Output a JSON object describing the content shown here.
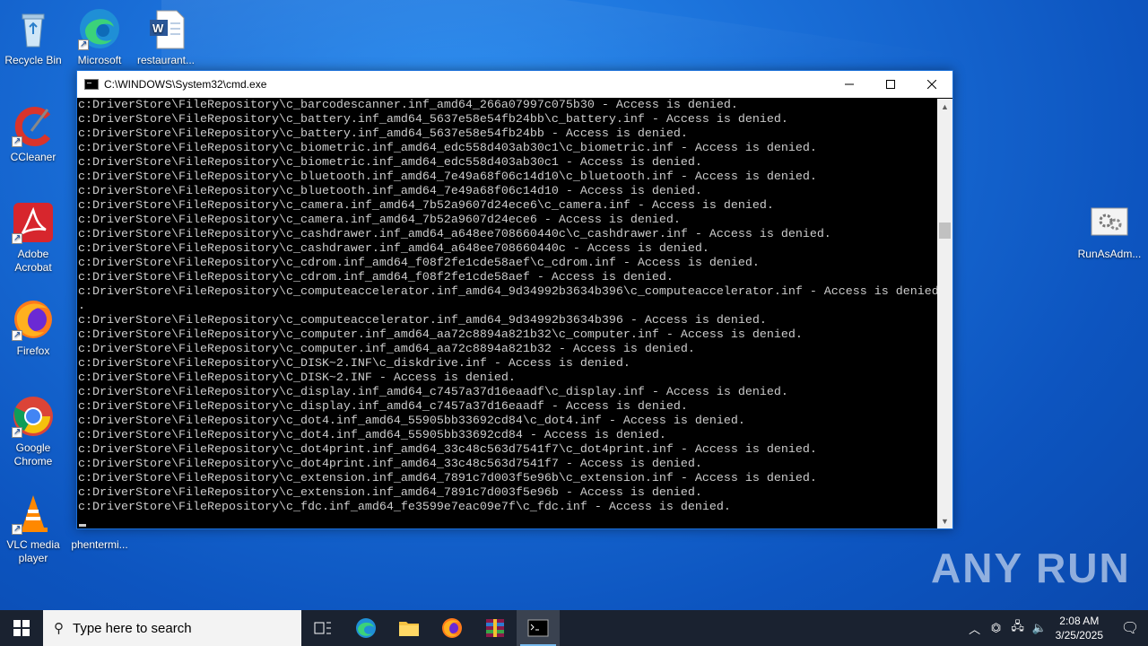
{
  "desktop": {
    "icons": [
      {
        "label": "Recycle Bin"
      },
      {
        "label": "Microsoft Edge"
      },
      {
        "label": "restaurant..."
      },
      {
        "label": "CCleaner"
      },
      {
        "label": "Adobe Acrobat"
      },
      {
        "label": "Firefox"
      },
      {
        "label": "Google Chrome"
      },
      {
        "label": "VLC media player"
      },
      {
        "label": "phentermi..."
      },
      {
        "label": "RunAsAdm..."
      }
    ]
  },
  "cmd": {
    "title": "C:\\WINDOWS\\System32\\cmd.exe",
    "lines": [
      "c:DriverStore\\FileRepository\\c_barcodescanner.inf_amd64_266a07997c075b30 - Access is denied.",
      "c:DriverStore\\FileRepository\\c_battery.inf_amd64_5637e58e54fb24bb\\c_battery.inf - Access is denied.",
      "c:DriverStore\\FileRepository\\c_battery.inf_amd64_5637e58e54fb24bb - Access is denied.",
      "c:DriverStore\\FileRepository\\c_biometric.inf_amd64_edc558d403ab30c1\\c_biometric.inf - Access is denied.",
      "c:DriverStore\\FileRepository\\c_biometric.inf_amd64_edc558d403ab30c1 - Access is denied.",
      "c:DriverStore\\FileRepository\\c_bluetooth.inf_amd64_7e49a68f06c14d10\\c_bluetooth.inf - Access is denied.",
      "c:DriverStore\\FileRepository\\c_bluetooth.inf_amd64_7e49a68f06c14d10 - Access is denied.",
      "c:DriverStore\\FileRepository\\c_camera.inf_amd64_7b52a9607d24ece6\\c_camera.inf - Access is denied.",
      "c:DriverStore\\FileRepository\\c_camera.inf_amd64_7b52a9607d24ece6 - Access is denied.",
      "c:DriverStore\\FileRepository\\c_cashdrawer.inf_amd64_a648ee708660440c\\c_cashdrawer.inf - Access is denied.",
      "c:DriverStore\\FileRepository\\c_cashdrawer.inf_amd64_a648ee708660440c - Access is denied.",
      "c:DriverStore\\FileRepository\\c_cdrom.inf_amd64_f08f2fe1cde58aef\\c_cdrom.inf - Access is denied.",
      "c:DriverStore\\FileRepository\\c_cdrom.inf_amd64_f08f2fe1cde58aef - Access is denied.",
      "c:DriverStore\\FileRepository\\c_computeaccelerator.inf_amd64_9d34992b3634b396\\c_computeaccelerator.inf - Access is denied",
      ".",
      "c:DriverStore\\FileRepository\\c_computeaccelerator.inf_amd64_9d34992b3634b396 - Access is denied.",
      "c:DriverStore\\FileRepository\\c_computer.inf_amd64_aa72c8894a821b32\\c_computer.inf - Access is denied.",
      "c:DriverStore\\FileRepository\\c_computer.inf_amd64_aa72c8894a821b32 - Access is denied.",
      "c:DriverStore\\FileRepository\\C_DISK~2.INF\\c_diskdrive.inf - Access is denied.",
      "c:DriverStore\\FileRepository\\C_DISK~2.INF - Access is denied.",
      "c:DriverStore\\FileRepository\\c_display.inf_amd64_c7457a37d16eaadf\\c_display.inf - Access is denied.",
      "c:DriverStore\\FileRepository\\c_display.inf_amd64_c7457a37d16eaadf - Access is denied.",
      "c:DriverStore\\FileRepository\\c_dot4.inf_amd64_55905bb33692cd84\\c_dot4.inf - Access is denied.",
      "c:DriverStore\\FileRepository\\c_dot4.inf_amd64_55905bb33692cd84 - Access is denied.",
      "c:DriverStore\\FileRepository\\c_dot4print.inf_amd64_33c48c563d7541f7\\c_dot4print.inf - Access is denied.",
      "c:DriverStore\\FileRepository\\c_dot4print.inf_amd64_33c48c563d7541f7 - Access is denied.",
      "c:DriverStore\\FileRepository\\c_extension.inf_amd64_7891c7d003f5e96b\\c_extension.inf - Access is denied.",
      "c:DriverStore\\FileRepository\\c_extension.inf_amd64_7891c7d003f5e96b - Access is denied.",
      "c:DriverStore\\FileRepository\\c_fdc.inf_amd64_fe3599e7eac09e7f\\c_fdc.inf - Access is denied."
    ]
  },
  "taskbar": {
    "search_placeholder": "Type here to search",
    "time": "2:08 AM",
    "date": "3/25/2025"
  },
  "watermark": "ANY RUN"
}
